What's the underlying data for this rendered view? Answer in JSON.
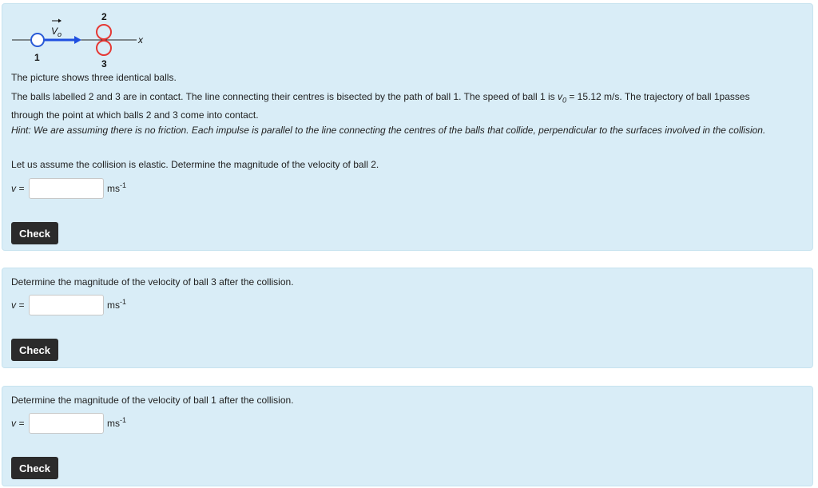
{
  "diagram": {
    "ball1_label": "1",
    "ball2_label": "2",
    "ball3_label": "3",
    "velocity_label": "V",
    "velocity_subscript": "o",
    "axis_label": "x",
    "colors": {
      "ball1": "#2a5bd7",
      "arrow": "#1f4fe0",
      "balls_23": "#e53935",
      "line": "#222222"
    }
  },
  "question1": {
    "intro": "The picture shows three identical balls.",
    "desc_before": "The balls labelled 2 and 3 are in contact. The line connecting their centres is bisected by the path of ball 1. The speed of ball 1 is ",
    "speed_var": "v",
    "speed_sub": "0",
    "speed_value": " = 15.12 m/s. The trajectory of ball 1passes through the point at which balls 2 and 3 come into contact.",
    "hint": "Hint: We are assuming there is no friction. Each impulse is parallel to the line connecting the centres of the balls that collide, perpendicular to the surfaces involved in the collision.",
    "question": "Let us assume the collision is elastic. Determine the magnitude of the velocity of ball 2.",
    "answer_label": "v =",
    "answer_value": "",
    "unit_base": "ms",
    "unit_exp": "-1",
    "check_label": "Check"
  },
  "question2": {
    "question": "Determine the magnitude of the velocity of ball 3 after the collision.",
    "answer_label": "v =",
    "answer_value": "",
    "unit_base": "ms",
    "unit_exp": "-1",
    "check_label": "Check"
  },
  "question3": {
    "question": "Determine the magnitude of the velocity of ball 1 after the collision.",
    "answer_label": "v =",
    "answer_value": "",
    "unit_base": "ms",
    "unit_exp": "-1",
    "check_label": "Check"
  }
}
